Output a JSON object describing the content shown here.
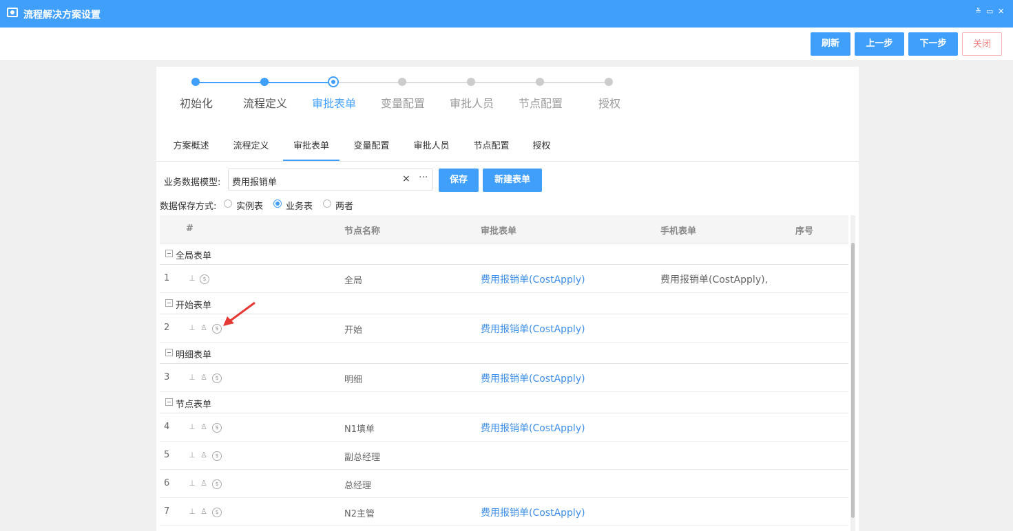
{
  "window": {
    "title": "流程解决方案设置",
    "controls": [
      "≚",
      "▭",
      "✕"
    ]
  },
  "toolbar": {
    "refresh": "刷新",
    "prev": "上一步",
    "next": "下一步",
    "close": "关闭"
  },
  "steps": [
    {
      "label": "初始化",
      "state": "done"
    },
    {
      "label": "流程定义",
      "state": "done"
    },
    {
      "label": "审批表单",
      "state": "current"
    },
    {
      "label": "变量配置",
      "state": "todo"
    },
    {
      "label": "审批人员",
      "state": "todo"
    },
    {
      "label": "节点配置",
      "state": "todo"
    },
    {
      "label": "授权",
      "state": "todo"
    }
  ],
  "tabs": [
    "方案概述",
    "流程定义",
    "审批表单",
    "变量配置",
    "审批人员",
    "节点配置",
    "授权"
  ],
  "active_tab": "审批表单",
  "form": {
    "model_label": "业务数据模型:",
    "model_value": "费用报销单",
    "clear_icon": "×",
    "more_icon": "···",
    "save": "保存",
    "new_form": "新建表单",
    "save_mode_label": "数据保存方式:",
    "save_modes": [
      "实例表",
      "业务表",
      "两者"
    ],
    "save_mode_selected": "业务表"
  },
  "grid": {
    "headers": {
      "index": "#",
      "node_name": "节点名称",
      "approval_form": "审批表单",
      "mobile_form": "手机表单",
      "order": "序号"
    },
    "groups": [
      {
        "name": "全局表单",
        "rows": [
          {
            "index": "1",
            "node": "全局",
            "form": "费用报销单(CostApply)",
            "mobile": "费用报销单(CostApply),",
            "icons": [
              "stamp-icon",
              "form-icon"
            ]
          }
        ]
      },
      {
        "name": "开始表单",
        "rows": [
          {
            "index": "2",
            "node": "开始",
            "form": "费用报销单(CostApply)",
            "mobile": "",
            "icons": [
              "stamp-icon",
              "user-icon",
              "form-icon"
            ]
          }
        ]
      },
      {
        "name": "明细表单",
        "rows": [
          {
            "index": "3",
            "node": "明细",
            "form": "费用报销单(CostApply)",
            "mobile": "",
            "icons": [
              "stamp-icon",
              "user-icon",
              "form-icon"
            ]
          }
        ]
      },
      {
        "name": "节点表单",
        "rows": [
          {
            "index": "4",
            "node": "N1填单",
            "form": "费用报销单(CostApply)",
            "mobile": "",
            "icons": [
              "stamp-icon",
              "user-icon",
              "form-icon"
            ]
          },
          {
            "index": "5",
            "node": "副总经理",
            "form": "",
            "mobile": "",
            "icons": [
              "stamp-icon",
              "user-icon",
              "form-icon"
            ]
          },
          {
            "index": "6",
            "node": "总经理",
            "form": "",
            "mobile": "",
            "icons": [
              "stamp-icon",
              "user-icon",
              "form-icon"
            ]
          },
          {
            "index": "7",
            "node": "N2主管",
            "form": "费用报销单(CostApply)",
            "mobile": "",
            "icons": [
              "stamp-icon",
              "user-icon",
              "form-icon"
            ]
          }
        ]
      }
    ]
  },
  "colors": {
    "accent": "#3f9ffb",
    "link": "#3f8fe8",
    "annotation_arrow": "#e53935"
  }
}
